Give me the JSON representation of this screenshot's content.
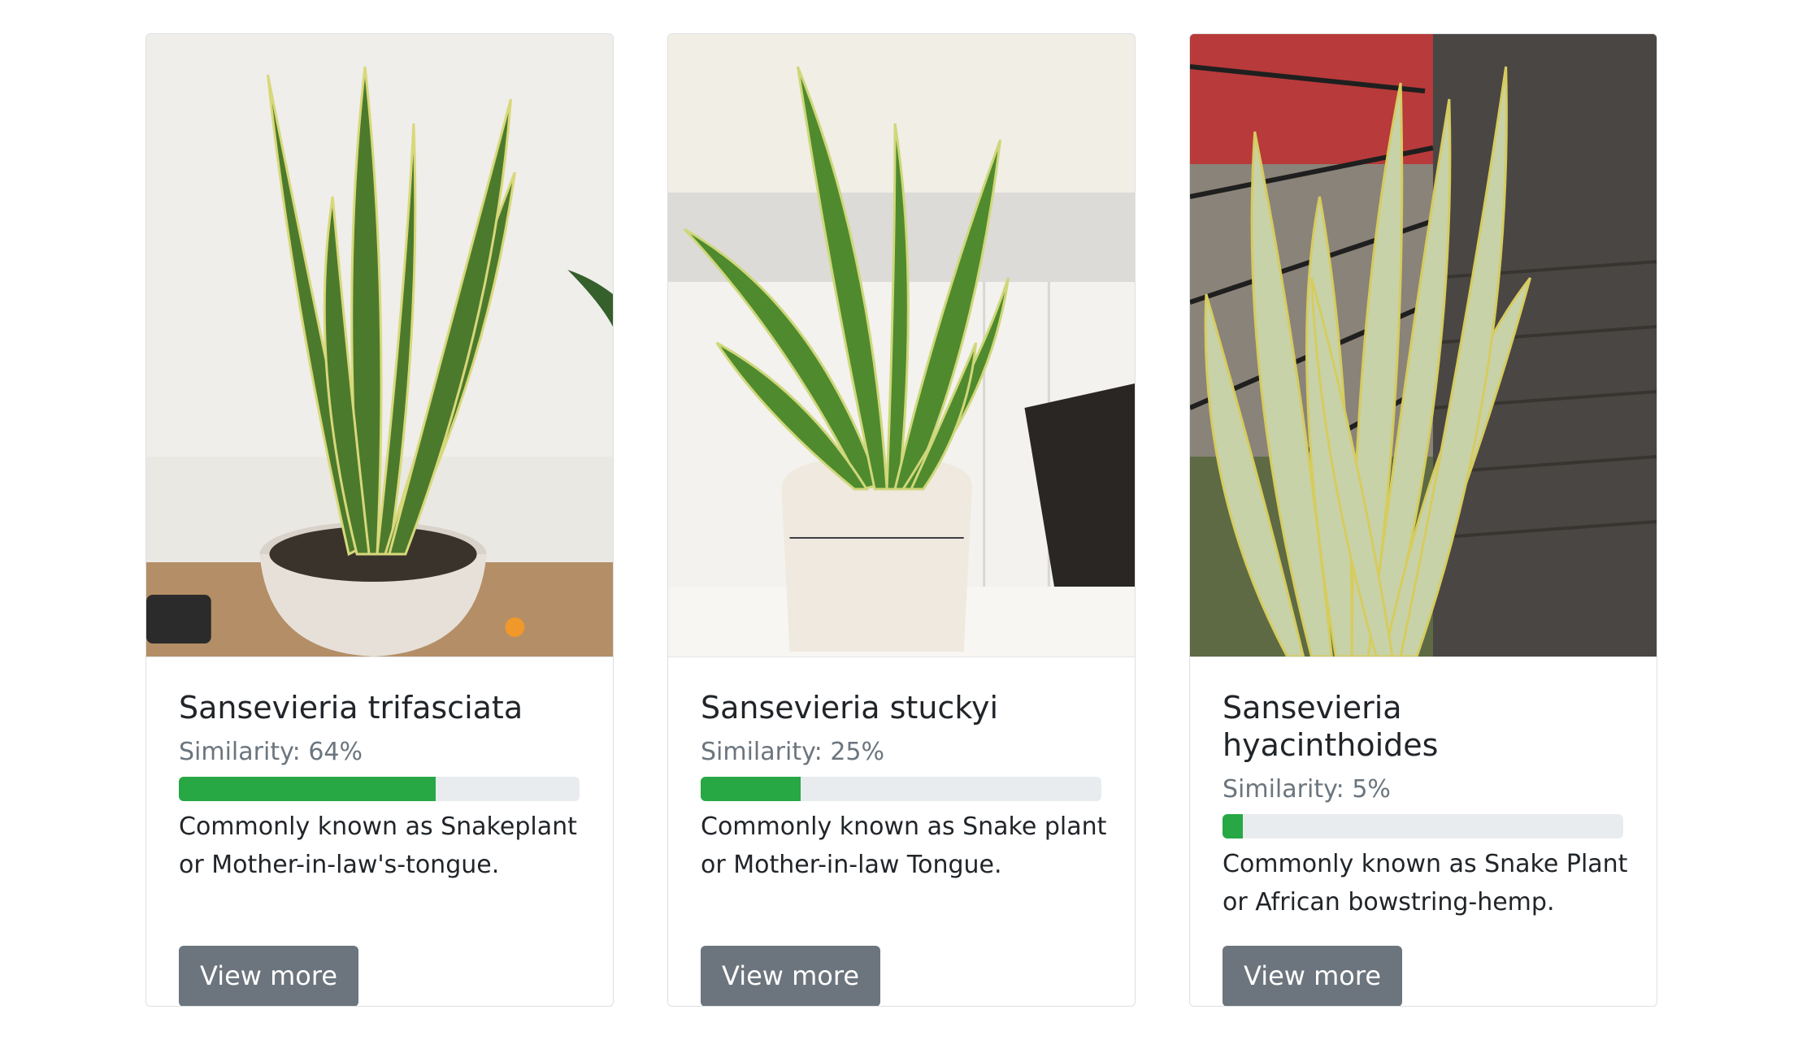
{
  "cards": [
    {
      "image_description": "sansevieria-trifasciata-photo",
      "title": "Sansevieria trifasciata",
      "similarity_label": "Similarity:",
      "similarity_value": "64%",
      "similarity_fraction": 0.64,
      "description": "Commonly known as Snakeplant or Mother-in-law's-tongue.",
      "button_label": "View more"
    },
    {
      "image_description": "sansevieria-stuckyi-photo",
      "title": "Sansevieria stuckyi",
      "similarity_label": "Similarity:",
      "similarity_value": "25%",
      "similarity_fraction": 0.25,
      "description": "Commonly known as Snake plant or Mother-in-law Tongue.",
      "button_label": "View more"
    },
    {
      "image_description": "sansevieria-hyacinthoides-photo",
      "title": "Sansevieria hyacinthoides",
      "similarity_label": "Similarity:",
      "similarity_value": "5%",
      "similarity_fraction": 0.05,
      "description": "Commonly known as Snake Plant or African bowstring-hemp.",
      "button_label": "View more"
    }
  ],
  "colors": {
    "progress_fill": "#28a745",
    "progress_track": "#e9ecef",
    "button_bg": "#6c757d",
    "muted_text": "#6c757d"
  }
}
